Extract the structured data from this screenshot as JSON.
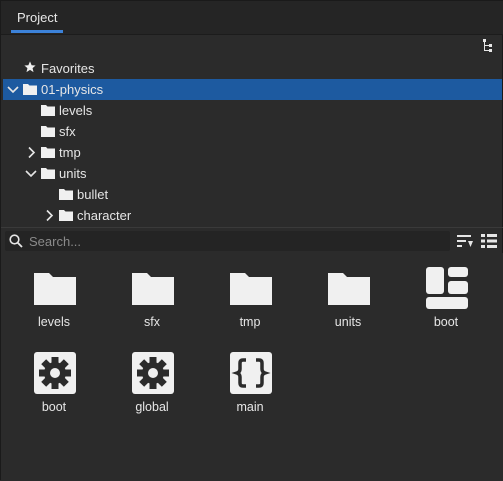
{
  "tab": {
    "label": "Project"
  },
  "tree": {
    "favorites": "Favorites",
    "items": [
      {
        "label": "01-physics",
        "selected": true,
        "expanded": true
      },
      {
        "label": "levels"
      },
      {
        "label": "sfx"
      },
      {
        "label": "tmp",
        "expanded": false
      },
      {
        "label": "units",
        "expanded": true
      },
      {
        "label": "bullet"
      },
      {
        "label": "character",
        "expanded": false
      }
    ]
  },
  "search": {
    "placeholder": "Search..."
  },
  "grid": {
    "items": [
      {
        "label": "levels",
        "icon": "folder-icon"
      },
      {
        "label": "sfx",
        "icon": "folder-icon"
      },
      {
        "label": "tmp",
        "icon": "folder-icon"
      },
      {
        "label": "units",
        "icon": "folder-icon"
      },
      {
        "label": "boot",
        "icon": "layout-icon"
      },
      {
        "label": "boot",
        "icon": "gear-icon"
      },
      {
        "label": "global",
        "icon": "gear-icon"
      },
      {
        "label": "main",
        "icon": "braces-icon"
      }
    ]
  },
  "colors": {
    "selection": "#1d5aa0",
    "tab_accent": "#3c82d9",
    "panel_bg": "#2b2b2b"
  }
}
